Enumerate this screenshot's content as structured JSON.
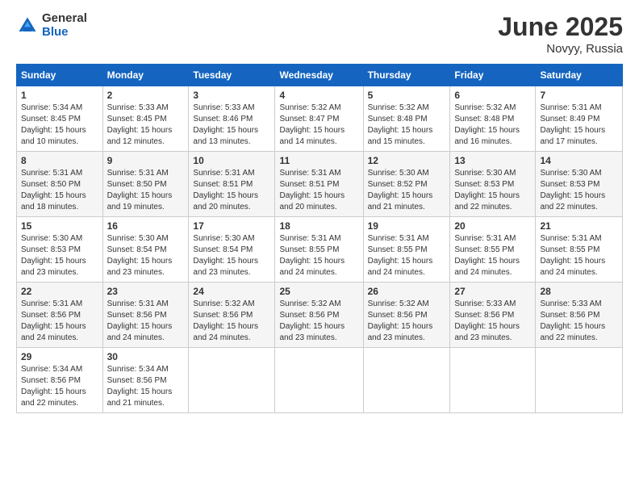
{
  "logo": {
    "general": "General",
    "blue": "Blue"
  },
  "title": "June 2025",
  "location": "Novyy, Russia",
  "days_header": [
    "Sunday",
    "Monday",
    "Tuesday",
    "Wednesday",
    "Thursday",
    "Friday",
    "Saturday"
  ],
  "weeks": [
    [
      {
        "day": "1",
        "info": "Sunrise: 5:34 AM\nSunset: 8:45 PM\nDaylight: 15 hours\nand 10 minutes."
      },
      {
        "day": "2",
        "info": "Sunrise: 5:33 AM\nSunset: 8:45 PM\nDaylight: 15 hours\nand 12 minutes."
      },
      {
        "day": "3",
        "info": "Sunrise: 5:33 AM\nSunset: 8:46 PM\nDaylight: 15 hours\nand 13 minutes."
      },
      {
        "day": "4",
        "info": "Sunrise: 5:32 AM\nSunset: 8:47 PM\nDaylight: 15 hours\nand 14 minutes."
      },
      {
        "day": "5",
        "info": "Sunrise: 5:32 AM\nSunset: 8:48 PM\nDaylight: 15 hours\nand 15 minutes."
      },
      {
        "day": "6",
        "info": "Sunrise: 5:32 AM\nSunset: 8:48 PM\nDaylight: 15 hours\nand 16 minutes."
      },
      {
        "day": "7",
        "info": "Sunrise: 5:31 AM\nSunset: 8:49 PM\nDaylight: 15 hours\nand 17 minutes."
      }
    ],
    [
      {
        "day": "8",
        "info": "Sunrise: 5:31 AM\nSunset: 8:50 PM\nDaylight: 15 hours\nand 18 minutes."
      },
      {
        "day": "9",
        "info": "Sunrise: 5:31 AM\nSunset: 8:50 PM\nDaylight: 15 hours\nand 19 minutes."
      },
      {
        "day": "10",
        "info": "Sunrise: 5:31 AM\nSunset: 8:51 PM\nDaylight: 15 hours\nand 20 minutes."
      },
      {
        "day": "11",
        "info": "Sunrise: 5:31 AM\nSunset: 8:51 PM\nDaylight: 15 hours\nand 20 minutes."
      },
      {
        "day": "12",
        "info": "Sunrise: 5:30 AM\nSunset: 8:52 PM\nDaylight: 15 hours\nand 21 minutes."
      },
      {
        "day": "13",
        "info": "Sunrise: 5:30 AM\nSunset: 8:53 PM\nDaylight: 15 hours\nand 22 minutes."
      },
      {
        "day": "14",
        "info": "Sunrise: 5:30 AM\nSunset: 8:53 PM\nDaylight: 15 hours\nand 22 minutes."
      }
    ],
    [
      {
        "day": "15",
        "info": "Sunrise: 5:30 AM\nSunset: 8:53 PM\nDaylight: 15 hours\nand 23 minutes."
      },
      {
        "day": "16",
        "info": "Sunrise: 5:30 AM\nSunset: 8:54 PM\nDaylight: 15 hours\nand 23 minutes."
      },
      {
        "day": "17",
        "info": "Sunrise: 5:30 AM\nSunset: 8:54 PM\nDaylight: 15 hours\nand 23 minutes."
      },
      {
        "day": "18",
        "info": "Sunrise: 5:31 AM\nSunset: 8:55 PM\nDaylight: 15 hours\nand 24 minutes."
      },
      {
        "day": "19",
        "info": "Sunrise: 5:31 AM\nSunset: 8:55 PM\nDaylight: 15 hours\nand 24 minutes."
      },
      {
        "day": "20",
        "info": "Sunrise: 5:31 AM\nSunset: 8:55 PM\nDaylight: 15 hours\nand 24 minutes."
      },
      {
        "day": "21",
        "info": "Sunrise: 5:31 AM\nSunset: 8:55 PM\nDaylight: 15 hours\nand 24 minutes."
      }
    ],
    [
      {
        "day": "22",
        "info": "Sunrise: 5:31 AM\nSunset: 8:56 PM\nDaylight: 15 hours\nand 24 minutes."
      },
      {
        "day": "23",
        "info": "Sunrise: 5:31 AM\nSunset: 8:56 PM\nDaylight: 15 hours\nand 24 minutes."
      },
      {
        "day": "24",
        "info": "Sunrise: 5:32 AM\nSunset: 8:56 PM\nDaylight: 15 hours\nand 24 minutes."
      },
      {
        "day": "25",
        "info": "Sunrise: 5:32 AM\nSunset: 8:56 PM\nDaylight: 15 hours\nand 23 minutes."
      },
      {
        "day": "26",
        "info": "Sunrise: 5:32 AM\nSunset: 8:56 PM\nDaylight: 15 hours\nand 23 minutes."
      },
      {
        "day": "27",
        "info": "Sunrise: 5:33 AM\nSunset: 8:56 PM\nDaylight: 15 hours\nand 23 minutes."
      },
      {
        "day": "28",
        "info": "Sunrise: 5:33 AM\nSunset: 8:56 PM\nDaylight: 15 hours\nand 22 minutes."
      }
    ],
    [
      {
        "day": "29",
        "info": "Sunrise: 5:34 AM\nSunset: 8:56 PM\nDaylight: 15 hours\nand 22 minutes."
      },
      {
        "day": "30",
        "info": "Sunrise: 5:34 AM\nSunset: 8:56 PM\nDaylight: 15 hours\nand 21 minutes."
      },
      {
        "day": "",
        "info": ""
      },
      {
        "day": "",
        "info": ""
      },
      {
        "day": "",
        "info": ""
      },
      {
        "day": "",
        "info": ""
      },
      {
        "day": "",
        "info": ""
      }
    ]
  ]
}
